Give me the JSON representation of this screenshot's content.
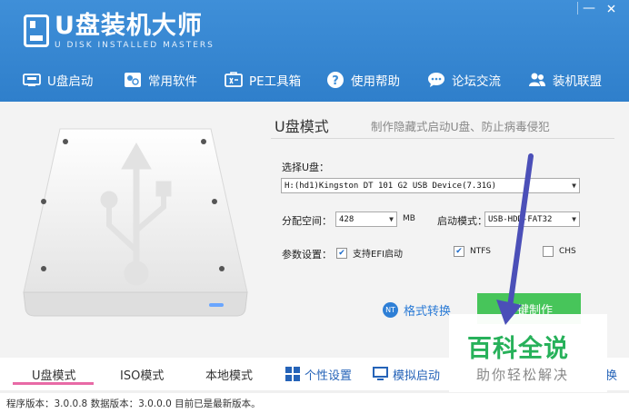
{
  "app": {
    "title": "U盘装机大师",
    "subtitle": "U DISK INSTALLED MASTERS"
  },
  "window_controls": {
    "minimize": "—",
    "close": "✕"
  },
  "nav": [
    {
      "label": "U盘启动",
      "icon": "usb-drive-icon"
    },
    {
      "label": "常用软件",
      "icon": "software-grid-icon"
    },
    {
      "label": "PE工具箱",
      "icon": "toolbox-icon"
    },
    {
      "label": "使用帮助",
      "icon": "help-icon"
    },
    {
      "label": "论坛交流",
      "icon": "chat-bubble-icon"
    },
    {
      "label": "装机联盟",
      "icon": "people-icon"
    }
  ],
  "main": {
    "mode_title": "U盘模式",
    "mode_desc": "制作隐藏式启动U盘、防止病毒侵犯",
    "select_disk_label": "选择U盘：",
    "select_disk_value": "H:(hd1)Kingston DT 101 G2 USB Device(7.31G)",
    "partition_label": "分配空间：",
    "partition_value": "428",
    "partition_unit": "MB",
    "boot_mode_label": "启动模式：",
    "boot_mode_value": "USB-HDD-FAT32",
    "params_label": "参数设置：",
    "efi_label": "支持EFI启动",
    "efi_checked": true,
    "ntfs_label": "NTFS",
    "ntfs_checked": true,
    "chs_label": "CHS",
    "chs_checked": false,
    "convert_label": "格式转换",
    "convert_icon_text": "NT",
    "make_button": "一键制作"
  },
  "tabs": [
    {
      "label": "U盘模式",
      "active": true
    },
    {
      "label": "ISO模式",
      "active": false
    },
    {
      "label": "本地模式",
      "active": false
    },
    {
      "label": "个性设置",
      "active": false,
      "icon": "grid-icon"
    },
    {
      "label": "模拟启动",
      "active": false,
      "icon": "monitor-icon"
    },
    {
      "label": "换",
      "active": false
    }
  ],
  "status": {
    "text": "程序版本：3.0.0.8  数据版本：3.0.0.0 目前已是最新版本。"
  },
  "watermark": {
    "title": "百科全说",
    "subtitle": "助你轻松解决"
  },
  "colors": {
    "header_blue": "#3f8fd8",
    "accent_green": "#47c55a",
    "tab_underline": "#e86aa6",
    "link_blue": "#2a7ad5",
    "overlay_arrow": "#4b4fb8"
  }
}
